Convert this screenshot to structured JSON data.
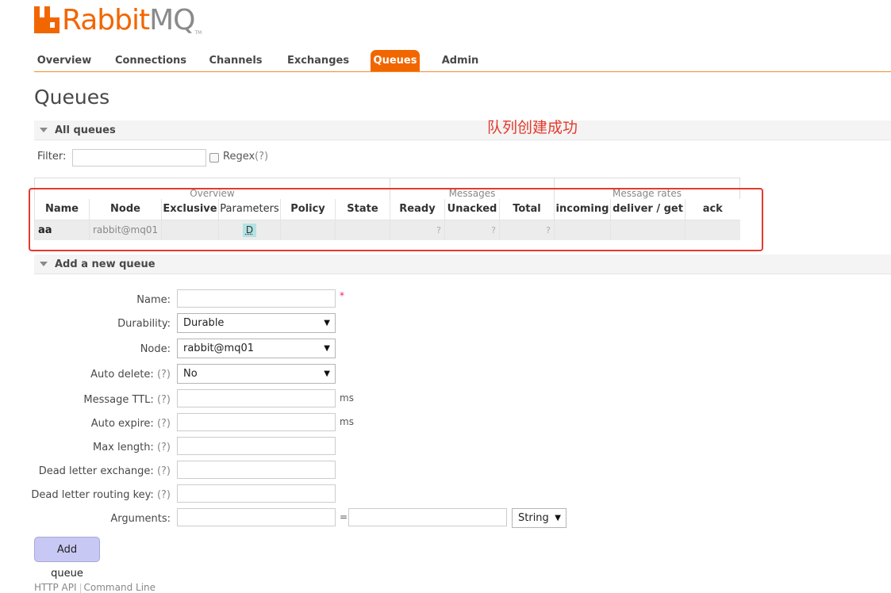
{
  "logo": {
    "rabbit": "Rabbit",
    "mq": "MQ",
    "tm": "TM"
  },
  "nav": {
    "tabs": [
      {
        "label": "Overview"
      },
      {
        "label": "Connections"
      },
      {
        "label": "Channels"
      },
      {
        "label": "Exchanges"
      },
      {
        "label": "Queues",
        "active": true
      },
      {
        "label": "Admin"
      }
    ]
  },
  "page_title": "Queues",
  "all_queues": {
    "title": "All queues",
    "annotation": "队列创建成功",
    "filter_label": "Filter:",
    "filter_value": "",
    "regex_label": "Regex",
    "regex_help": "(?)",
    "groups": [
      "Overview",
      "Messages",
      "Message rates"
    ],
    "columns": [
      "Name",
      "Node",
      "Exclusive",
      "Parameters",
      "Policy",
      "State",
      "Ready",
      "Unacked",
      "Total",
      "incoming",
      "deliver / get",
      "ack"
    ],
    "rows": [
      {
        "name": "aa",
        "node": "rabbit@mq01",
        "exclusive": "",
        "parameters": "D",
        "policy": "",
        "state": "",
        "ready": "?",
        "unacked": "?",
        "total": "?",
        "incoming": "",
        "deliver_get": "",
        "ack": ""
      }
    ]
  },
  "add_queue": {
    "title": "Add a new queue",
    "name_label": "Name:",
    "required_mark": "*",
    "durability_label": "Durability:",
    "durability_value": "Durable",
    "node_label": "Node:",
    "node_value": "rabbit@mq01",
    "auto_delete_label": "Auto delete:",
    "auto_delete_value": "No",
    "message_ttl_label": "Message TTL:",
    "auto_expire_label": "Auto expire:",
    "max_length_label": "Max length:",
    "dlx_label": "Dead letter exchange:",
    "dlrk_label": "Dead letter routing key:",
    "arguments_label": "Arguments:",
    "arguments_type": "String",
    "equals": "=",
    "ms": "ms",
    "help": "(?)",
    "arrow": "▼",
    "submit": "Add queue"
  },
  "footer": {
    "http_api": "HTTP API",
    "command_line": "Command Line"
  },
  "colors": {
    "accent": "#f26600",
    "annotation": "#e23b2e",
    "button": "#c8c8f4",
    "badge": "#b3e3e3"
  }
}
